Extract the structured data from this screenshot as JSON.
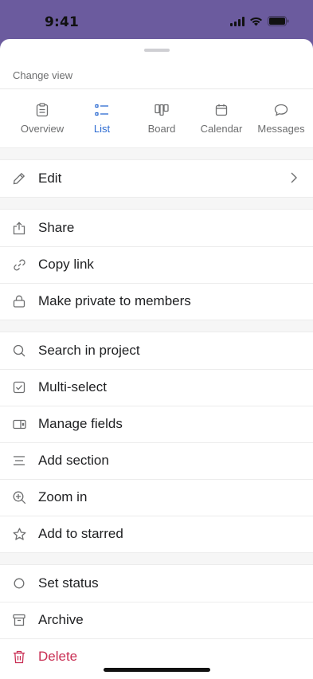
{
  "status_bar": {
    "time": "9:41"
  },
  "sheet": {
    "change_view_label": "Change view",
    "tabs": [
      {
        "label": "Overview",
        "icon": "clipboard-icon",
        "active": false
      },
      {
        "label": "List",
        "icon": "list-icon",
        "active": true
      },
      {
        "label": "Board",
        "icon": "board-icon",
        "active": false
      },
      {
        "label": "Calendar",
        "icon": "calendar-icon",
        "active": false
      },
      {
        "label": "Messages",
        "icon": "chat-bubble-icon",
        "active": false
      }
    ],
    "groups": [
      {
        "items": [
          {
            "label": "Edit",
            "icon": "pencil-icon",
            "has_chevron": true
          }
        ]
      },
      {
        "items": [
          {
            "label": "Share",
            "icon": "share-icon"
          },
          {
            "label": "Copy link",
            "icon": "link-icon"
          },
          {
            "label": "Make private to members",
            "icon": "lock-icon"
          }
        ]
      },
      {
        "items": [
          {
            "label": "Search in project",
            "icon": "search-icon"
          },
          {
            "label": "Multi-select",
            "icon": "checkbox-icon"
          },
          {
            "label": "Manage fields",
            "icon": "fields-icon"
          },
          {
            "label": "Add section",
            "icon": "section-lines-icon"
          },
          {
            "label": "Zoom in",
            "icon": "zoom-in-icon"
          },
          {
            "label": "Add to starred",
            "icon": "star-icon"
          }
        ]
      },
      {
        "items": [
          {
            "label": "Set status",
            "icon": "circle-icon"
          },
          {
            "label": "Archive",
            "icon": "archive-icon"
          },
          {
            "label": "Delete",
            "icon": "trash-icon",
            "danger": true
          }
        ]
      }
    ]
  },
  "colors": {
    "accent": "#2b6ad1",
    "danger": "#c92f54",
    "header_bg": "#6b5b9e"
  }
}
